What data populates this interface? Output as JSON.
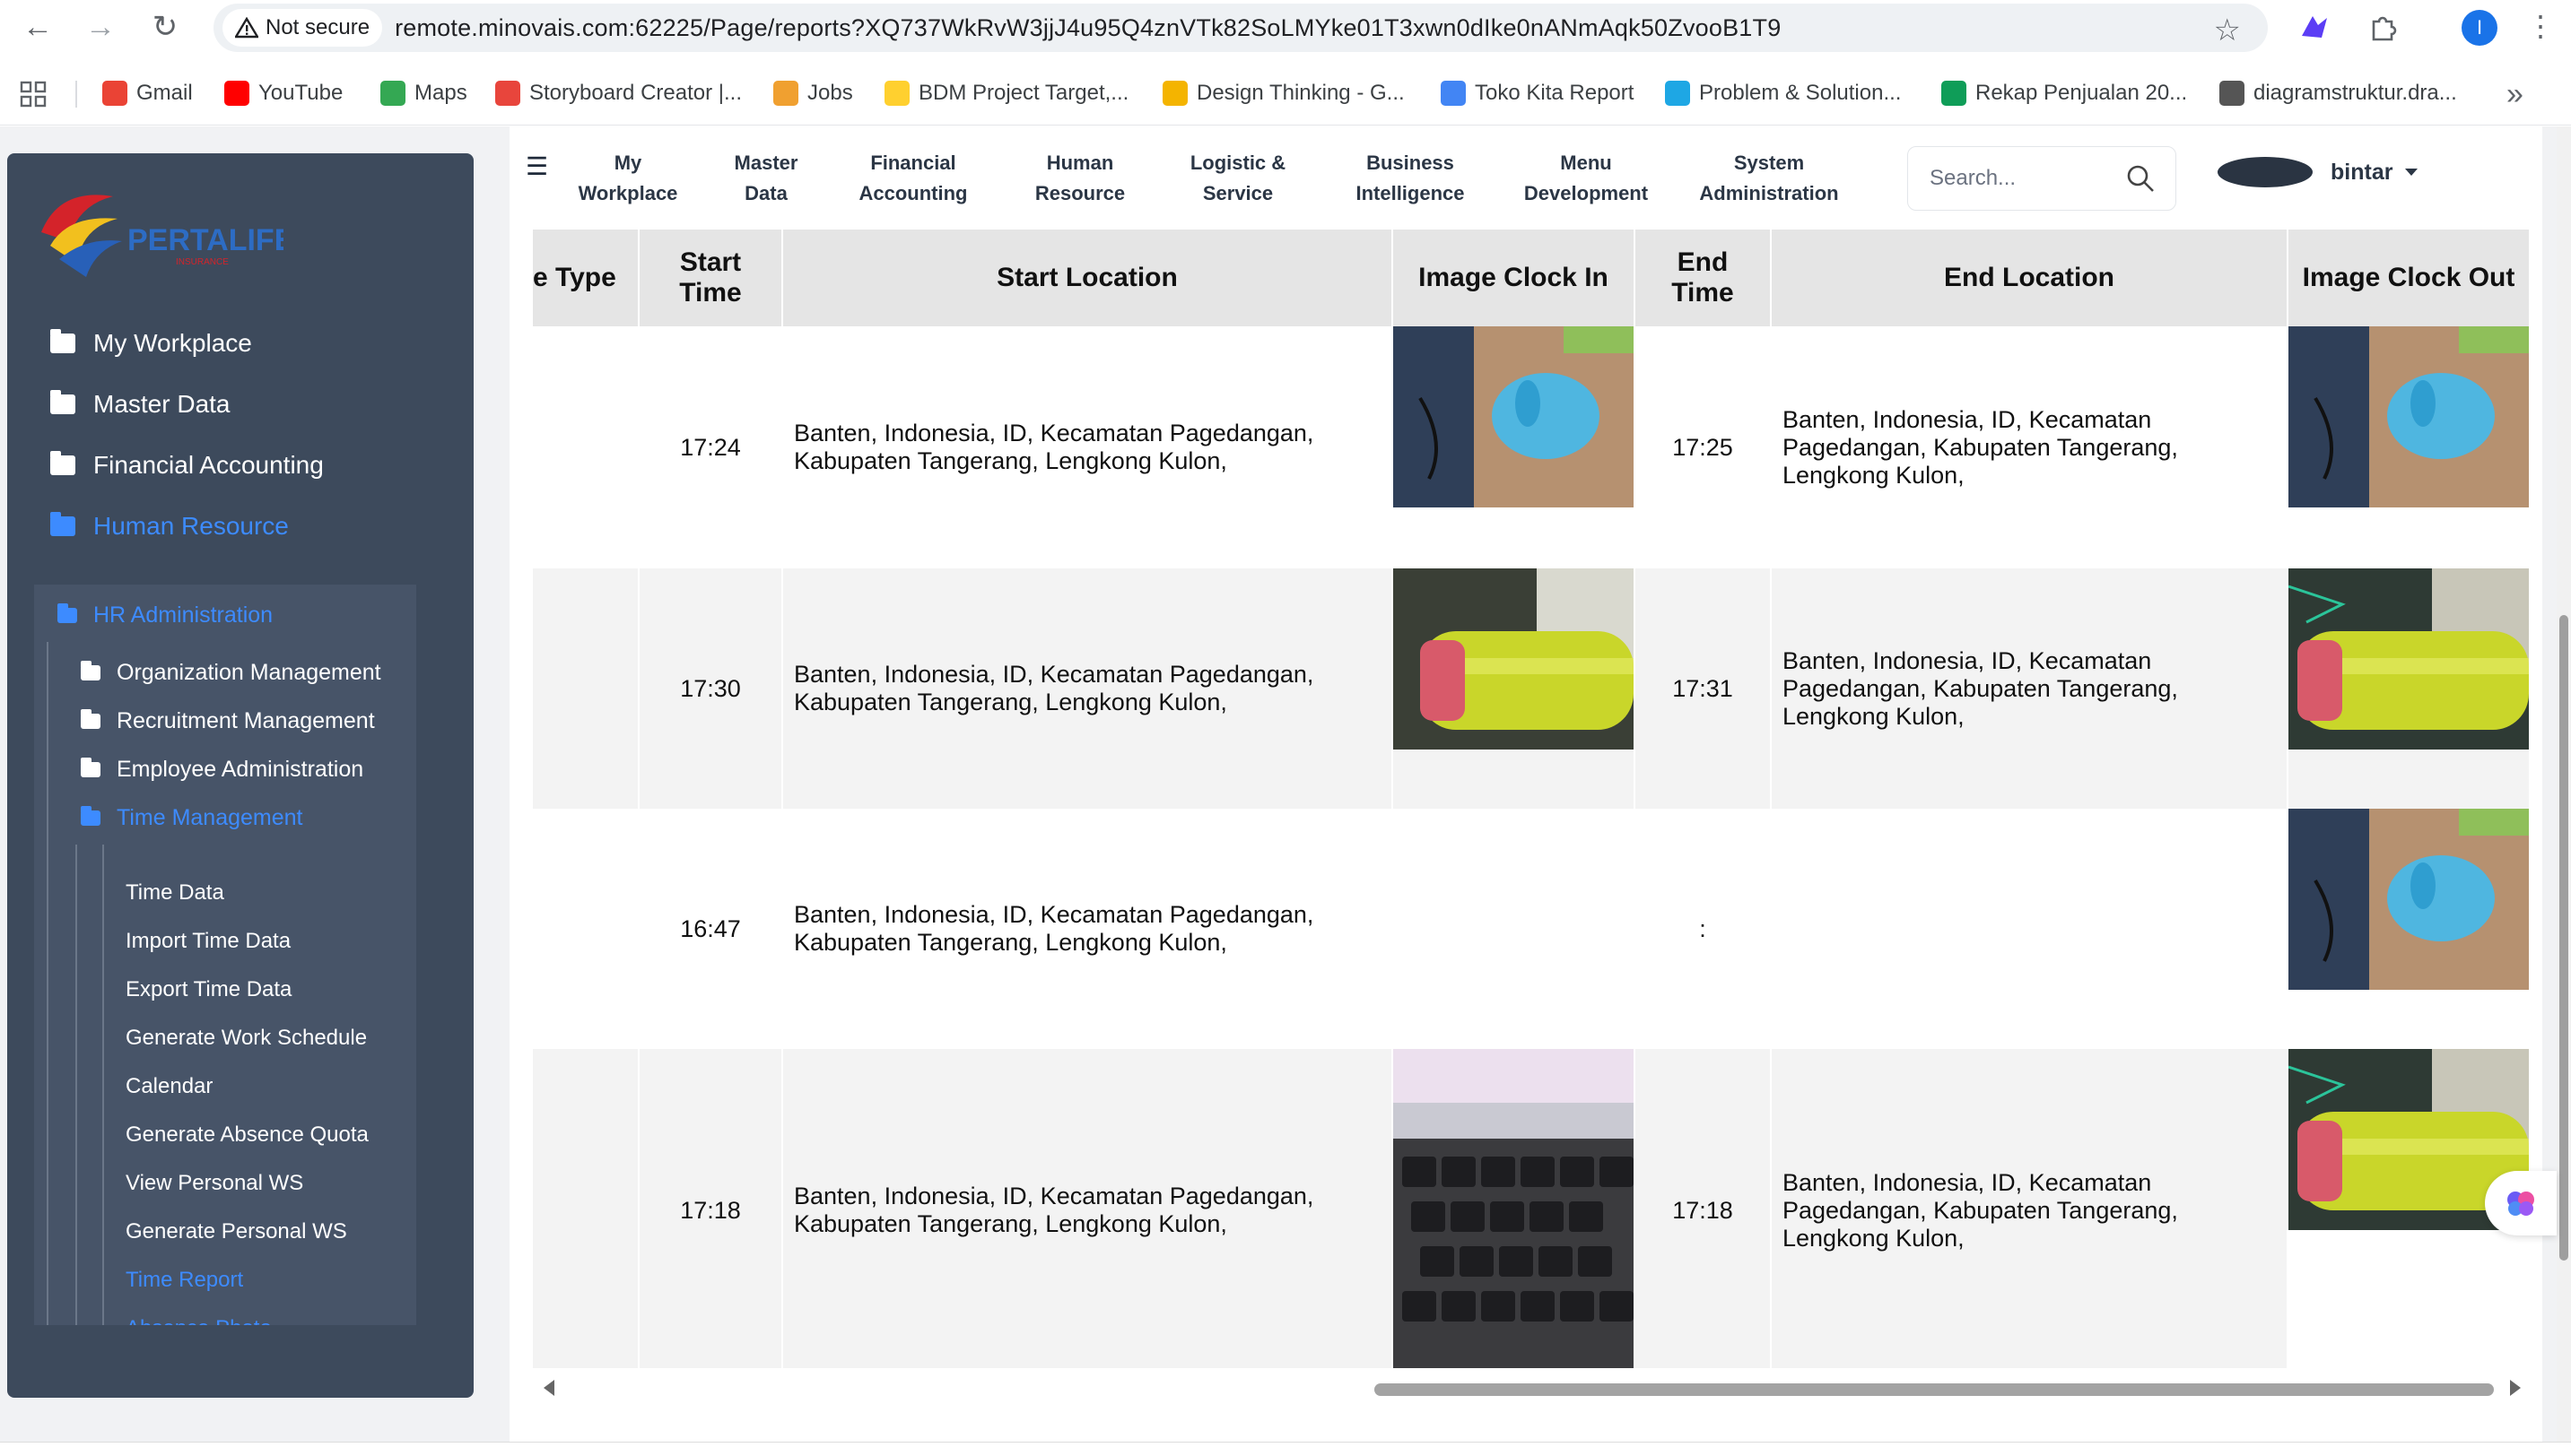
{
  "browser": {
    "security_label": "Not secure",
    "url": "remote.minovais.com:62225/Page/reports?XQ737WkRvW3jjJ4u95Q4znVTk82SoLMYke01T3xwn0dIke0nANmAqk50ZvooB1T9",
    "profile_initial": "I",
    "bookmarks": [
      {
        "label": "Gmail",
        "icon": "gmail-icon",
        "color": "#ea4335"
      },
      {
        "label": "YouTube",
        "icon": "youtube-icon",
        "color": "#ff0000"
      },
      {
        "label": "Maps",
        "icon": "maps-icon",
        "color": "#34a853"
      },
      {
        "label": "Storyboard Creator |...",
        "icon": "storyboard-icon",
        "color": "#e8453c"
      },
      {
        "label": "Jobs",
        "icon": "jobs-icon",
        "color": "#f0a030"
      },
      {
        "label": "BDM Project Target,...",
        "icon": "miro-icon",
        "color": "#ffd02f"
      },
      {
        "label": "Design Thinking - G...",
        "icon": "slides-icon",
        "color": "#f4b400"
      },
      {
        "label": "Toko Kita Report",
        "icon": "looker-icon",
        "color": "#4285f4"
      },
      {
        "label": "Problem & Solution...",
        "icon": "canva-icon",
        "color": "#1ea7e4"
      },
      {
        "label": "Rekap Penjualan 20...",
        "icon": "sheets-icon",
        "color": "#0f9d58"
      },
      {
        "label": "diagramstruktur.dra...",
        "icon": "diagram-icon",
        "color": "#555555"
      }
    ]
  },
  "sidebar": {
    "logo_text": "PERTALIFE",
    "logo_sub": "INSURANCE",
    "top_items": [
      {
        "label": "My Workplace",
        "active": false
      },
      {
        "label": "Master Data",
        "active": false
      },
      {
        "label": "Financial Accounting",
        "active": false
      },
      {
        "label": "Human Resource",
        "active": true
      }
    ],
    "hr_admin": "HR Administration",
    "sub_items": [
      {
        "label": "Organization Management",
        "active": false
      },
      {
        "label": "Recruitment Management",
        "active": false
      },
      {
        "label": "Employee Administration",
        "active": false
      },
      {
        "label": "Time Management",
        "active": true
      }
    ],
    "time_items": [
      {
        "label": "Time Data",
        "active": false
      },
      {
        "label": "Import Time Data",
        "active": false
      },
      {
        "label": "Export Time Data",
        "active": false
      },
      {
        "label": "Generate Work Schedule",
        "active": false
      },
      {
        "label": "Calendar",
        "active": false
      },
      {
        "label": "Generate Absence Quota",
        "active": false
      },
      {
        "label": "View Personal WS",
        "active": false
      },
      {
        "label": "Generate Personal WS",
        "active": false
      },
      {
        "label": "Time Report",
        "active": true
      },
      {
        "label": "Absence Photo",
        "active": true
      }
    ]
  },
  "topnav": {
    "items": [
      {
        "label": "My\nWorkplace"
      },
      {
        "label": "Master\nData"
      },
      {
        "label": "Financial\nAccounting"
      },
      {
        "label": "Human\nResource"
      },
      {
        "label": "Logistic &\nService"
      },
      {
        "label": "Business\nIntelligence"
      },
      {
        "label": "Menu\nDevelopment"
      },
      {
        "label": "System\nAdministration"
      }
    ],
    "search_placeholder": "Search...",
    "user_name": "bintar"
  },
  "table": {
    "headers": [
      "e Type",
      "Start\nTime",
      "Start Location",
      "Image Clock In",
      "End\nTime",
      "End Location",
      "Image Clock Out"
    ],
    "rows": [
      {
        "type": "",
        "start_time": "17:24",
        "start_location": "Banten, Indonesia, ID, Kecamatan Pagedangan, Kabupaten Tangerang, Lengkong Kulon,",
        "clock_in_image": "mouse-photo",
        "end_time": "17:25",
        "end_location": "Banten, Indonesia, ID, Kecamatan Pagedangan, Kabupaten Tangerang, Lengkong Kulon,",
        "clock_out_image": "mouse-photo"
      },
      {
        "type": "",
        "start_time": "17:30",
        "start_location": "Banten, Indonesia, ID, Kecamatan Pagedangan, Kabupaten Tangerang, Lengkong Kulon,",
        "clock_in_image": "bottle-photo",
        "end_time": "17:31",
        "end_location": "Banten, Indonesia, ID, Kecamatan Pagedangan, Kabupaten Tangerang, Lengkong Kulon,",
        "clock_out_image": "bottle-photo"
      },
      {
        "type": "",
        "start_time": "16:47",
        "start_location": "Banten, Indonesia, ID, Kecamatan Pagedangan, Kabupaten Tangerang, Lengkong Kulon,",
        "clock_in_image": "",
        "end_time": ":",
        "end_location": "",
        "clock_out_image": "mouse-photo"
      },
      {
        "type": "",
        "start_time": "17:18",
        "start_location": "Banten, Indonesia, ID, Kecamatan Pagedangan, Kabupaten Tangerang, Lengkong Kulon,",
        "clock_in_image": "keyboard-photo",
        "end_time": "17:18",
        "end_location": "Banten, Indonesia, ID, Kecamatan Pagedangan, Kabupaten Tangerang, Lengkong Kulon,",
        "clock_out_image": "bottle-photo"
      }
    ]
  },
  "colors": {
    "sidebar_bg": "#3d4a5c",
    "active_blue": "#3d8bff",
    "header_bg": "#e5e5e5"
  }
}
